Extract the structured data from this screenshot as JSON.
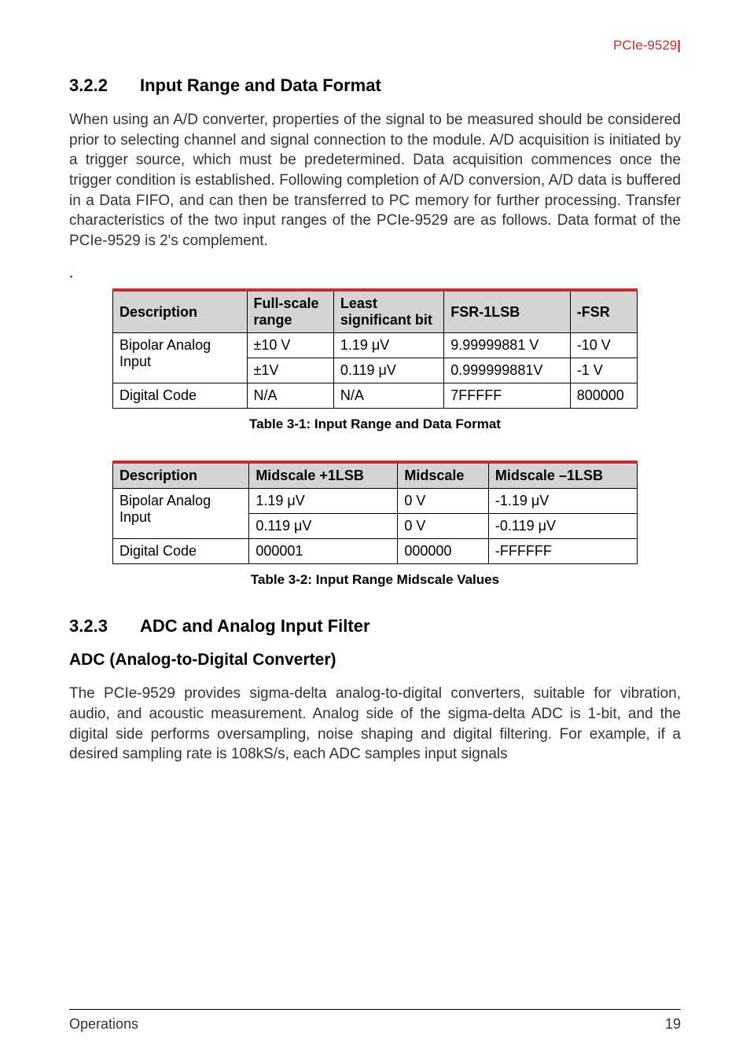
{
  "header": {
    "product": "PCIe-9529",
    "bar": "|"
  },
  "section322": {
    "number": "3.2.2",
    "title": "Input Range and Data Format",
    "paragraph": "When using an A/D converter, properties of the signal to be measured should be considered prior to selecting channel and signal connection to the module. A/D acquisition is initiated by a trigger source, which must be predetermined. Data acquisition commences once the trigger condition is established. Following completion of A/D conversion, A/D data is buffered in a Data FIFO, and can then be transferred to PC memory for further processing. Transfer characteristics of the two input ranges of the PCIe-9529 are as follows. Data format of the PCIe-9529 is 2's complement."
  },
  "dot": ".",
  "table1": {
    "headers": {
      "c1": "Description",
      "c2": "Full-scale range",
      "c3": "Least significant bit",
      "c4": "FSR-1LSB",
      "c5": "-FSR"
    },
    "rows": [
      {
        "desc": "Bipolar Analog Input",
        "range": "±10 V",
        "lsb": "1.19 μV",
        "fsr1lsb": "9.99999881 V",
        "nfsr": "-10 V"
      },
      {
        "range": "±1V",
        "lsb": "0.119 μV",
        "fsr1lsb": "0.999999881V",
        "nfsr": "-1 V"
      },
      {
        "desc": "Digital Code",
        "range": "N/A",
        "lsb": "N/A",
        "fsr1lsb": "7FFFFF",
        "nfsr": "800000"
      }
    ],
    "caption": "Table  3-1: Input Range and Data Format"
  },
  "table2": {
    "headers": {
      "c1": "Description",
      "c2": "Midscale +1LSB",
      "c3": "Midscale",
      "c4": "Midscale –1LSB"
    },
    "rows": [
      {
        "desc": "Bipolar Analog Input",
        "mp1": "1.19 μV",
        "mid": "0 V",
        "mm1": "-1.19 μV"
      },
      {
        "mp1": "0.119 μV",
        "mid": "0 V",
        "mm1": "-0.119 μV"
      },
      {
        "desc": "Digital Code",
        "mp1": "000001",
        "mid": "000000",
        "mm1": "-FFFFFF"
      }
    ],
    "caption": "Table  3-2: Input Range Midscale Values"
  },
  "section323": {
    "number": "3.2.3",
    "title": "ADC and Analog Input Filter",
    "sub": "ADC (Analog-to-Digital Converter)",
    "paragraph": "The PCIe-9529 provides sigma-delta analog-to-digital converters, suitable for vibration, audio, and acoustic measurement. Analog side of the sigma-delta ADC is 1-bit, and the digital side performs oversampling, noise shaping and digital filtering. For example, if a desired sampling rate is 108kS/s, each ADC samples input signals"
  },
  "footer": {
    "left": "Operations",
    "right": "19"
  }
}
